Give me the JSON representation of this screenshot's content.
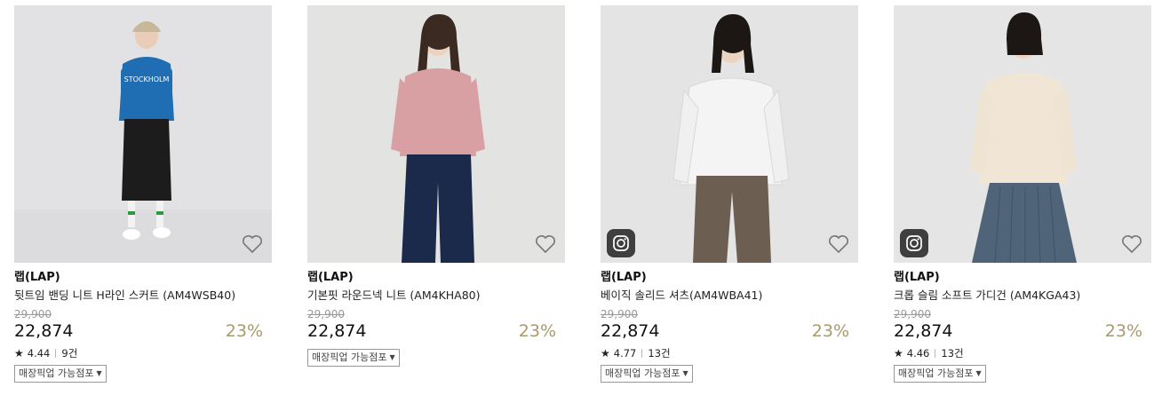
{
  "products": [
    {
      "brand": "랩(LAP)",
      "name": "뒷트임 밴딩 니트 H라인 스커트 (AM4WSB40)",
      "original_price": "29,900",
      "price": "22,874",
      "discount": "23%",
      "rating": "4.44",
      "reviews": "9건",
      "pickup_label": "매장픽업 가능점포",
      "has_instagram": false
    },
    {
      "brand": "랩(LAP)",
      "name": "기본핏 라운드넥 니트 (AM4KHA80)",
      "original_price": "29,900",
      "price": "22,874",
      "discount": "23%",
      "rating": "",
      "reviews": "",
      "pickup_label": "매장픽업 가능점포",
      "has_instagram": false
    },
    {
      "brand": "랩(LAP)",
      "name": "베이직 솔리드 셔츠(AM4WBA41)",
      "original_price": "29,900",
      "price": "22,874",
      "discount": "23%",
      "rating": "4.77",
      "reviews": "13건",
      "pickup_label": "매장픽업 가능점포",
      "has_instagram": true
    },
    {
      "brand": "랩(LAP)",
      "name": "크롭 슬림 소프트 가디건 (AM4KGA43)",
      "original_price": "29,900",
      "price": "22,874",
      "discount": "23%",
      "rating": "4.46",
      "reviews": "13건",
      "pickup_label": "매장픽업 가능점포",
      "has_instagram": true
    }
  ],
  "icons": {
    "wishlist": "heart-outline-icon",
    "instagram": "instagram-icon",
    "rating": "star-icon",
    "dropdown": "caret-down-icon"
  },
  "colors": {
    "discount": "#a89a6e",
    "original_price": "#999999",
    "insta_badge": "#3f3f3f"
  }
}
